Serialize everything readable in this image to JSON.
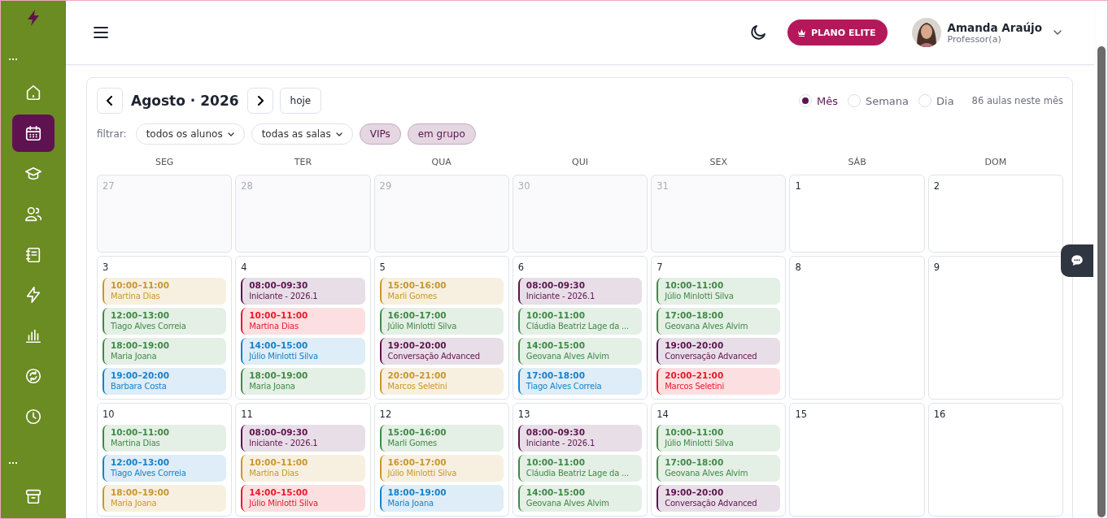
{
  "sidebar": {
    "items": [
      {
        "selected": false
      },
      {
        "selected": true
      },
      {
        "selected": false
      },
      {
        "selected": false
      },
      {
        "selected": false
      },
      {
        "selected": false
      },
      {
        "selected": false
      },
      {
        "selected": false
      },
      {
        "selected": false
      },
      {
        "selected": false
      }
    ]
  },
  "header": {
    "upgrade_button": "PLANO ELITE",
    "user": {
      "name": "Amanda Araújo",
      "role": "Professor(a)"
    }
  },
  "calendar": {
    "title": "Agosto · 2026",
    "today_button": "hoje",
    "views": [
      {
        "label": "Mês",
        "selected": true
      },
      {
        "label": "Semana",
        "selected": false
      },
      {
        "label": "Dia",
        "selected": false
      }
    ],
    "count": "86 aulas neste mês",
    "filter_label": "filtrar:",
    "dropdowns": [
      "todos os alunos",
      "todas as salas"
    ],
    "chips": [
      {
        "label": "VIPs",
        "selected": true
      },
      {
        "label": "em grupo",
        "selected": true
      }
    ],
    "weekdays": [
      "SEG",
      "TER",
      "QUA",
      "QUI",
      "SEX",
      "SÁB",
      "DOM"
    ],
    "weeks": [
      {
        "days": [
          {
            "day": "27",
            "outside": true
          },
          {
            "day": "28",
            "outside": true
          },
          {
            "day": "29",
            "outside": true
          },
          {
            "day": "30",
            "outside": true
          },
          {
            "day": "31",
            "outside": true
          },
          {
            "day": "1",
            "outside": false
          },
          {
            "day": "2",
            "outside": false
          }
        ]
      },
      {
        "days": [
          {
            "day": "3",
            "outside": false,
            "events": [
              {
                "time": "10:00–11:00",
                "title": "Martina Dias",
                "color": "#c9962b"
              },
              {
                "time": "12:00–13:00",
                "title": "Tiago Alves Correia",
                "color": "#3f8a46"
              },
              {
                "time": "18:00–19:00",
                "title": "Maria Joana",
                "color": "#3f8a46"
              },
              {
                "time": "19:00–20:00",
                "title": "Barbara Costa",
                "color": "#1681c9"
              }
            ]
          },
          {
            "day": "4",
            "outside": false,
            "events": [
              {
                "time": "08:00–09:30",
                "title": "Iniciante - 2026.1",
                "color": "#5e1350"
              },
              {
                "time": "10:00–11:00",
                "title": "Martina Dias",
                "color": "#e8192c"
              },
              {
                "time": "14:00–15:00",
                "title": "Júlio Minlotti Silva",
                "color": "#1681c9"
              },
              {
                "time": "18:00–19:00",
                "title": "Maria Joana",
                "color": "#3f8a46"
              }
            ]
          },
          {
            "day": "5",
            "outside": false,
            "events": [
              {
                "time": "15:00–16:00",
                "title": "Marli Gomes",
                "color": "#c9962b"
              },
              {
                "time": "16:00–17:00",
                "title": "Júlio Minlotti Silva",
                "color": "#3f8a46"
              },
              {
                "time": "19:00–20:00",
                "title": "Conversação Advanced",
                "color": "#5e1350"
              },
              {
                "time": "20:00–21:00",
                "title": "Marcos Seletini",
                "color": "#c9962b"
              }
            ]
          },
          {
            "day": "6",
            "outside": false,
            "events": [
              {
                "time": "08:00–09:30",
                "title": "Iniciante - 2026.1",
                "color": "#5e1350"
              },
              {
                "time": "10:00–11:00",
                "title": "Cláudia Beatriz Lage da ...",
                "color": "#3f8a46"
              },
              {
                "time": "14:00–15:00",
                "title": "Geovana Alves Alvim",
                "color": "#3f8a46"
              },
              {
                "time": "17:00–18:00",
                "title": "Tiago Alves Correia",
                "color": "#1681c9"
              }
            ]
          },
          {
            "day": "7",
            "outside": false,
            "events": [
              {
                "time": "10:00–11:00",
                "title": "Júlio Minlotti Silva",
                "color": "#3f8a46"
              },
              {
                "time": "17:00–18:00",
                "title": "Geovana Alves Alvim",
                "color": "#3f8a46"
              },
              {
                "time": "19:00–20:00",
                "title": "Conversação Advanced",
                "color": "#5e1350"
              },
              {
                "time": "20:00–21:00",
                "title": "Marcos Seletini",
                "color": "#e8192c"
              }
            ]
          },
          {
            "day": "8",
            "outside": false
          },
          {
            "day": "9",
            "outside": false
          }
        ]
      },
      {
        "days": [
          {
            "day": "10",
            "outside": false,
            "events": [
              {
                "time": "10:00–11:00",
                "title": "Martina Dias",
                "color": "#3f8a46"
              },
              {
                "time": "12:00–13:00",
                "title": "Tiago Alves Correia",
                "color": "#1681c9"
              },
              {
                "time": "18:00–19:00",
                "title": "Maria Joana",
                "color": "#c9962b"
              }
            ]
          },
          {
            "day": "11",
            "outside": false,
            "events": [
              {
                "time": "08:00–09:30",
                "title": "Iniciante - 2026.1",
                "color": "#5e1350"
              },
              {
                "time": "10:00–11:00",
                "title": "Martina Dias",
                "color": "#c9962b"
              },
              {
                "time": "14:00–15:00",
                "title": "Júlio Minlotti Silva",
                "color": "#e8192c"
              }
            ]
          },
          {
            "day": "12",
            "outside": false,
            "events": [
              {
                "time": "15:00–16:00",
                "title": "Marli Gomes",
                "color": "#3f8a46"
              },
              {
                "time": "16:00–17:00",
                "title": "Júlio Minlotti Silva",
                "color": "#c9962b"
              },
              {
                "time": "18:00–19:00",
                "title": "Maria Joana",
                "color": "#1681c9"
              }
            ]
          },
          {
            "day": "13",
            "outside": false,
            "events": [
              {
                "time": "08:00–09:30",
                "title": "Iniciante - 2026.1",
                "color": "#5e1350"
              },
              {
                "time": "10:00–11:00",
                "title": "Cláudia Beatriz Lage da ...",
                "color": "#3f8a46"
              },
              {
                "time": "14:00–15:00",
                "title": "Geovana Alves Alvim",
                "color": "#3f8a46"
              }
            ]
          },
          {
            "day": "14",
            "outside": false,
            "events": [
              {
                "time": "10:00–11:00",
                "title": "Júlio Minlotti Silva",
                "color": "#3f8a46"
              },
              {
                "time": "17:00–18:00",
                "title": "Geovana Alves Alvim",
                "color": "#3f8a46"
              },
              {
                "time": "19:00–20:00",
                "title": "Conversação Advanced",
                "color": "#5e1350"
              }
            ]
          },
          {
            "day": "15",
            "outside": false
          },
          {
            "day": "16",
            "outside": false
          }
        ]
      }
    ]
  }
}
